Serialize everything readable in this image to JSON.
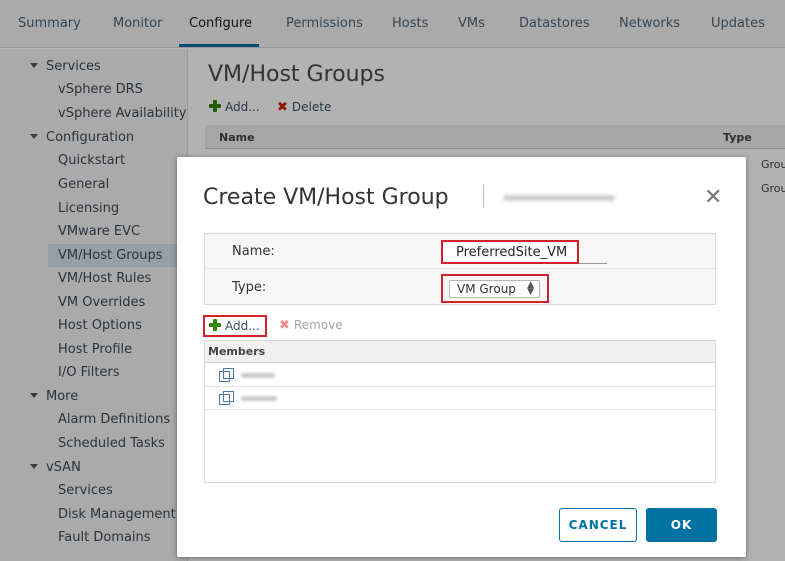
{
  "tabs": [
    {
      "label": "Summary",
      "active": false
    },
    {
      "label": "Monitor",
      "active": false
    },
    {
      "label": "Configure",
      "active": true
    },
    {
      "label": "Permissions",
      "active": false
    },
    {
      "label": "Hosts",
      "active": false
    },
    {
      "label": "VMs",
      "active": false
    },
    {
      "label": "Datastores",
      "active": false
    },
    {
      "label": "Networks",
      "active": false
    },
    {
      "label": "Updates",
      "active": false
    }
  ],
  "sidebar": {
    "sections": [
      {
        "label": "Services",
        "items": [
          "vSphere DRS",
          "vSphere Availability"
        ]
      },
      {
        "label": "Configuration",
        "items": [
          "Quickstart",
          "General",
          "Licensing",
          "VMware EVC",
          "VM/Host Groups",
          "VM/Host Rules",
          "VM Overrides",
          "Host Options",
          "Host Profile",
          "I/O Filters"
        ]
      },
      {
        "label": "More",
        "items": [
          "Alarm Definitions",
          "Scheduled Tasks"
        ]
      },
      {
        "label": "vSAN",
        "items": [
          "Services",
          "Disk Management",
          "Fault Domains"
        ]
      }
    ],
    "selected": "VM/Host Groups"
  },
  "main": {
    "title": "VM/Host Groups",
    "toolbar": {
      "add_label": "Add...",
      "delete_label": "Delete"
    },
    "grid": {
      "columns": [
        "Name",
        "Type"
      ],
      "type_cells": [
        "Group",
        "Group"
      ]
    }
  },
  "modal": {
    "title": "Create VM/Host Group",
    "close_icon": "close-icon",
    "form": {
      "name_label": "Name:",
      "name_value": "PreferredSite_VM",
      "type_label": "Type:",
      "type_value": "VM Group"
    },
    "members_toolbar": {
      "add_label": "Add...",
      "remove_label": "Remove"
    },
    "members_grid": {
      "header": "Members"
    },
    "buttons": {
      "cancel": "CANCEL",
      "ok": "OK"
    }
  },
  "colors": {
    "accent": "#0072a3",
    "highlight_box": "#d0222b",
    "add_icon": "#318700",
    "delete_icon": "#c92100"
  }
}
